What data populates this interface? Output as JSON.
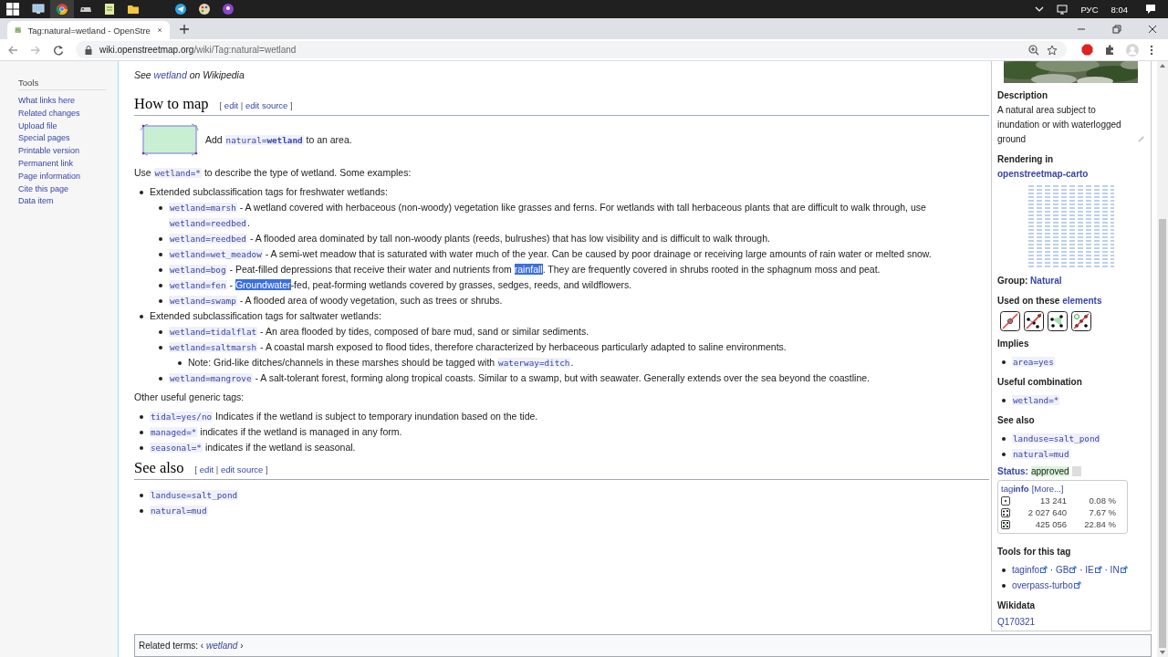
{
  "taskbar": {
    "apps": [
      {
        "kind": "monitor",
        "active": false
      },
      {
        "kind": "chrome",
        "active": true
      },
      {
        "kind": "gamepad",
        "active": false
      },
      {
        "kind": "notepad",
        "active": false
      },
      {
        "kind": "folder",
        "active": false
      },
      {
        "kind": "blank",
        "active": false
      },
      {
        "kind": "telegram",
        "active": false
      },
      {
        "kind": "palette",
        "active": false
      },
      {
        "kind": "podcast",
        "active": false
      }
    ],
    "language": "РУС",
    "time": "8:04"
  },
  "browser": {
    "tab_title": "Tag:natural=wetland - OpenStre",
    "url_host": "wiki.openstreetmap.org",
    "url_path": "/wiki/Tag:natural=wetland"
  },
  "sidebar": {
    "heading": "Tools",
    "items": [
      "What links here",
      "Related changes",
      "Upload file",
      "Special pages",
      "Printable version",
      "Permanent link",
      "Page information",
      "Cite this page",
      "Data item"
    ]
  },
  "article": {
    "wikipedia_note": [
      {
        "kind": "text",
        "text": "See "
      },
      {
        "kind": "link",
        "text": "wetland"
      },
      {
        "kind": "text",
        "text": " on Wikipedia"
      }
    ],
    "sections": [
      {
        "heading": "How to map",
        "edit": [
          {
            "kind": "text",
            "text": "[ "
          },
          {
            "kind": "link",
            "text": "edit"
          },
          {
            "kind": "text",
            "text": " | "
          },
          {
            "kind": "link",
            "text": "edit source"
          },
          {
            "kind": "text",
            "text": " ]"
          }
        ],
        "blocks": [
          {
            "kind": "area",
            "parts": [
              {
                "kind": "text",
                "text": "Add "
              },
              {
                "kind": "tag",
                "text": "natural=**wetland**"
              },
              {
                "kind": "text",
                "text": " to an area."
              }
            ]
          },
          {
            "kind": "para",
            "parts": [
              {
                "kind": "text",
                "text": "Use "
              },
              {
                "kind": "tag",
                "text": "wetland=*"
              },
              {
                "kind": "text",
                "text": " to describe the type of wetland. Some examples:"
              }
            ]
          },
          {
            "kind": "list",
            "items": [
              {
                "parts": [
                  {
                    "kind": "text",
                    "text": "Extended subclassification tags for freshwater wetlands:"
                  }
                ],
                "children": [
                  {
                    "parts": [
                      {
                        "kind": "tag",
                        "text": "wetland=marsh"
                      },
                      {
                        "kind": "text",
                        "text": " - A wetland covered with herbaceous (non-woody) vegetation like grasses and ferns. For wetlands with tall herbaceous plants that are difficult to walk through, use "
                      },
                      {
                        "kind": "tag",
                        "text": "wetland=reedbed"
                      },
                      {
                        "kind": "text",
                        "text": "."
                      }
                    ]
                  },
                  {
                    "parts": [
                      {
                        "kind": "tag",
                        "text": "wetland=reedbed"
                      },
                      {
                        "kind": "text",
                        "text": " - A flooded area dominated by tall non-woody plants (reeds, bulrushes) that has low visibility and is difficult to walk through."
                      }
                    ]
                  },
                  {
                    "parts": [
                      {
                        "kind": "tag",
                        "text": "wetland=wet_meadow"
                      },
                      {
                        "kind": "text",
                        "text": " - A semi-wet meadow that is saturated with water much of the year. Can be caused by poor drainage or receiving large amounts of rain water or melted snow."
                      }
                    ]
                  },
                  {
                    "parts": [
                      {
                        "kind": "tag",
                        "text": "wetland=bog"
                      },
                      {
                        "kind": "text",
                        "text": " - Peat-filled depressions that receive their water and nutrients from "
                      },
                      {
                        "kind": "selected",
                        "text": "rainfall"
                      },
                      {
                        "kind": "text",
                        "text": ". They are frequently covered in shrubs rooted in the sphagnum moss and peat."
                      }
                    ]
                  },
                  {
                    "parts": [
                      {
                        "kind": "tag",
                        "text": "wetland=fen"
                      },
                      {
                        "kind": "text",
                        "text": " - "
                      },
                      {
                        "kind": "selected",
                        "text": "Groundwater"
                      },
                      {
                        "kind": "text",
                        "text": "-fed, peat-forming wetlands covered by grasses, sedges, reeds, and wildflowers."
                      }
                    ]
                  },
                  {
                    "parts": [
                      {
                        "kind": "tag",
                        "text": "wetland=swamp"
                      },
                      {
                        "kind": "text",
                        "text": " - A flooded area of woody vegetation, such as trees or shrubs."
                      }
                    ]
                  }
                ]
              },
              {
                "parts": [
                  {
                    "kind": "text",
                    "text": "Extended subclassification tags for saltwater wetlands:"
                  }
                ],
                "children": [
                  {
                    "parts": [
                      {
                        "kind": "tag",
                        "text": "wetland=tidalflat"
                      },
                      {
                        "kind": "text",
                        "text": " - An area flooded by tides, composed of bare mud, sand or similar sediments."
                      }
                    ]
                  },
                  {
                    "parts": [
                      {
                        "kind": "tag",
                        "text": "wetland=saltmarsh"
                      },
                      {
                        "kind": "text",
                        "text": " - A coastal marsh exposed to flood tides, therefore characterized by herbaceous particularly adapted to saline environments."
                      }
                    ],
                    "children": [
                      {
                        "parts": [
                          {
                            "kind": "text",
                            "text": "Note: Grid-like ditches/channels in these marshes should be tagged with "
                          },
                          {
                            "kind": "tag",
                            "text": "waterway=ditch"
                          },
                          {
                            "kind": "text",
                            "text": "."
                          }
                        ]
                      }
                    ]
                  },
                  {
                    "parts": [
                      {
                        "kind": "tag",
                        "text": "wetland=mangrove"
                      },
                      {
                        "kind": "text",
                        "text": " - A salt-tolerant forest, forming along tropical coasts. Similar to a swamp, but with seawater. Generally extends over the sea beyond the coastline."
                      }
                    ]
                  }
                ]
              }
            ]
          },
          {
            "kind": "para",
            "parts": [
              {
                "kind": "text",
                "text": "Other useful generic tags:"
              }
            ]
          },
          {
            "kind": "list",
            "items": [
              {
                "parts": [
                  {
                    "kind": "tag",
                    "text": "tidal=yes/no"
                  },
                  {
                    "kind": "text",
                    "text": " Indicates if the wetland is subject to temporary inundation based on the tide."
                  }
                ]
              },
              {
                "parts": [
                  {
                    "kind": "tag",
                    "text": "managed=*"
                  },
                  {
                    "kind": "text",
                    "text": " indicates if the wetland is managed in any form."
                  }
                ]
              },
              {
                "parts": [
                  {
                    "kind": "tag",
                    "text": "seasonal=*"
                  },
                  {
                    "kind": "text",
                    "text": " indicates if the wetland is seasonal."
                  }
                ]
              }
            ]
          }
        ]
      },
      {
        "heading": "See also",
        "edit": [
          {
            "kind": "text",
            "text": "[ "
          },
          {
            "kind": "link",
            "text": "edit"
          },
          {
            "kind": "text",
            "text": " | "
          },
          {
            "kind": "link",
            "text": "edit source"
          },
          {
            "kind": "text",
            "text": " ]"
          }
        ],
        "blocks": [
          {
            "kind": "list",
            "items": [
              {
                "parts": [
                  {
                    "kind": "tag",
                    "text": "landuse=salt_pond"
                  }
                ]
              },
              {
                "parts": [
                  {
                    "kind": "tag",
                    "text": "natural=mud"
                  }
                ]
              }
            ]
          }
        ]
      }
    ],
    "related_terms": [
      {
        "kind": "text",
        "text": "Related terms: ‹ "
      },
      {
        "kind": "link",
        "text": "*wetland*"
      },
      {
        "kind": "text",
        "text": " ›"
      }
    ]
  },
  "infobox": {
    "description_heading": "Description",
    "description": "A natural area subject to inundation or with waterlogged ground",
    "rendering": [
      {
        "kind": "text",
        "text": "Rendering in "
      },
      {
        "kind": "link",
        "text": "openstreetmap-carto"
      }
    ],
    "group": [
      {
        "kind": "text",
        "text": "Group: "
      },
      {
        "kind": "link",
        "text": "Natural"
      }
    ],
    "elements_heading": [
      {
        "kind": "text",
        "text": "Used on these "
      },
      {
        "kind": "link",
        "text": "elements"
      }
    ],
    "elements": [
      {
        "kind": "node",
        "allowed": false
      },
      {
        "kind": "way",
        "allowed": false
      },
      {
        "kind": "area",
        "allowed": true
      },
      {
        "kind": "relation",
        "allowed": false
      }
    ],
    "lists": [
      {
        "heading": "Implies",
        "items": [
          {
            "parts": [
              {
                "kind": "tag",
                "text": "area=yes"
              }
            ]
          }
        ]
      },
      {
        "heading": "Useful combination",
        "items": [
          {
            "parts": [
              {
                "kind": "tag",
                "text": "wetland=*"
              }
            ]
          }
        ]
      },
      {
        "heading": "See also",
        "items": [
          {
            "parts": [
              {
                "kind": "tag",
                "text": "landuse=salt_pond"
              }
            ]
          },
          {
            "parts": [
              {
                "kind": "tag",
                "text": "natural=mud"
              }
            ]
          }
        ]
      }
    ],
    "status": {
      "label": "Status:",
      "value": "approved"
    },
    "taginfo": {
      "title": [
        {
          "kind": "link",
          "text": "tag**info**"
        },
        {
          "kind": "link",
          "text": "[More...]"
        }
      ],
      "rows": [
        {
          "kind": "node",
          "count": "13 241",
          "percent": "0.08 %"
        },
        {
          "kind": "way",
          "count": "2 027 640",
          "percent": "7.67 %"
        },
        {
          "kind": "relation",
          "count": "425 056",
          "percent": "22.84 %"
        }
      ]
    },
    "tools_heading": "Tools for this tag",
    "tools": [
      {
        "parts": [
          {
            "kind": "ext",
            "text": "taginfo"
          },
          {
            "kind": "text",
            "text": " · "
          },
          {
            "kind": "ext",
            "text": "GB"
          },
          {
            "kind": "text",
            "text": " · "
          },
          {
            "kind": "ext",
            "text": "IE"
          },
          {
            "kind": "text",
            "text": " · "
          },
          {
            "kind": "ext",
            "text": "IN"
          }
        ]
      },
      {
        "parts": [
          {
            "kind": "ext",
            "text": "overpass-turbo"
          }
        ]
      }
    ],
    "wikidata_heading": "Wikidata",
    "wikidata": "Q170321"
  }
}
